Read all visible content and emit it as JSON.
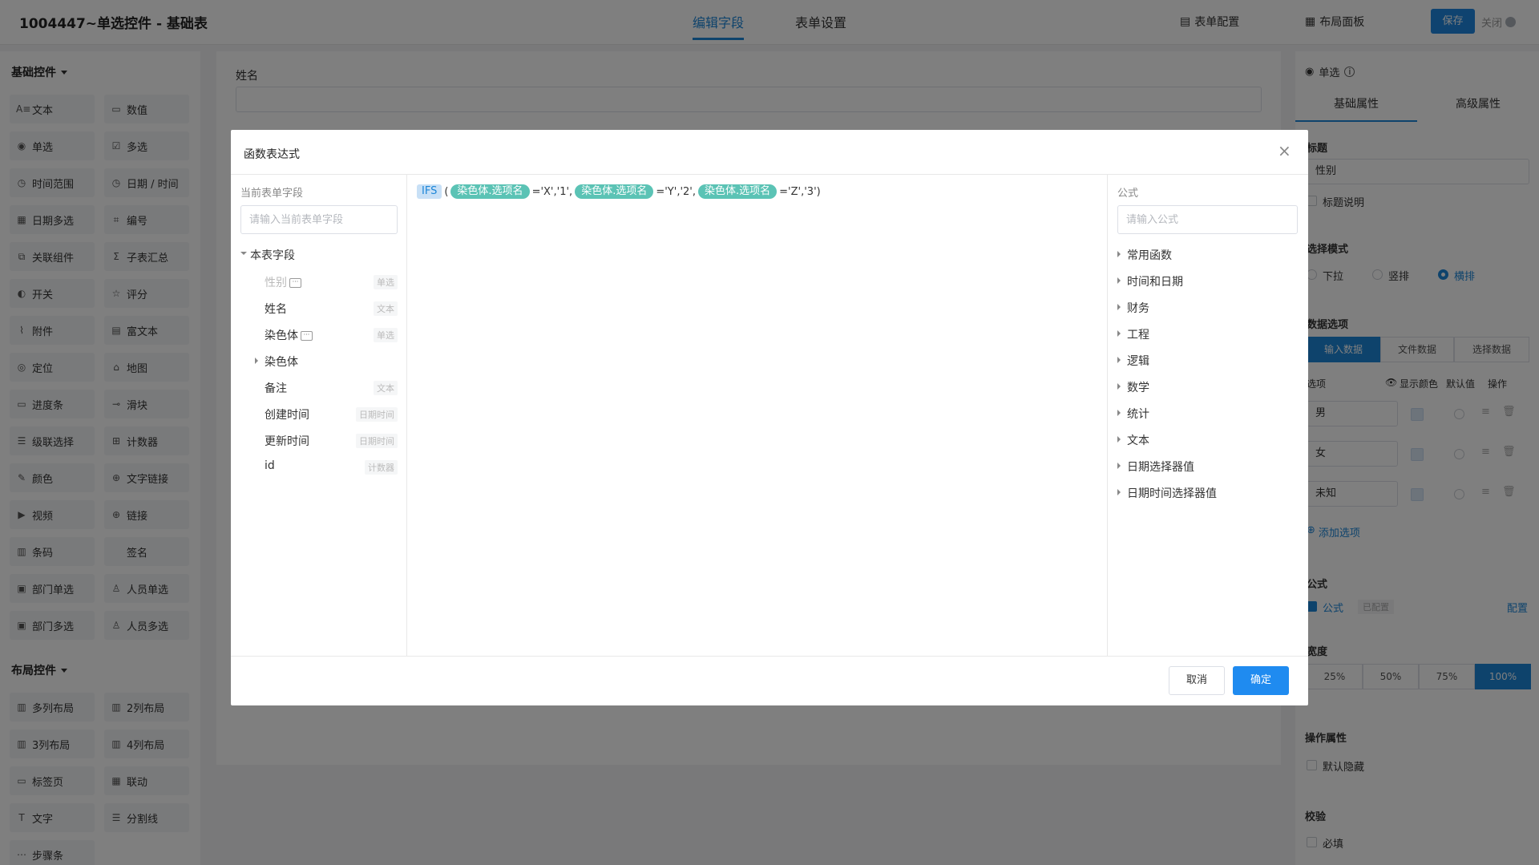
{
  "header": {
    "title": "1004447~单选控件 - 基础表",
    "tabs": [
      "编辑字段",
      "表单设置"
    ],
    "form_config": "表单配置",
    "layout_panel": "布局面板",
    "save": "保存",
    "close": "关闭"
  },
  "left": {
    "basic_title": "基础控件",
    "basic": [
      {
        "label": "文本",
        "icon": "text-icon"
      },
      {
        "label": "数值",
        "icon": "number-icon"
      },
      {
        "label": "单选",
        "icon": "radio-icon"
      },
      {
        "label": "多选",
        "icon": "checkbox-icon"
      },
      {
        "label": "时间范围",
        "icon": "clock-icon"
      },
      {
        "label": "日期 / 时间",
        "icon": "clock-icon"
      },
      {
        "label": "日期多选",
        "icon": "calendar-icon"
      },
      {
        "label": "编号",
        "icon": "id-icon"
      },
      {
        "label": "关联组件",
        "icon": "link-component-icon"
      },
      {
        "label": "子表汇总",
        "icon": "sigma-icon"
      },
      {
        "label": "开关",
        "icon": "toggle-icon"
      },
      {
        "label": "评分",
        "icon": "star-icon"
      },
      {
        "label": "附件",
        "icon": "paperclip-icon"
      },
      {
        "label": "富文本",
        "icon": "richtext-icon"
      },
      {
        "label": "定位",
        "icon": "location-icon"
      },
      {
        "label": "地图",
        "icon": "map-icon"
      },
      {
        "label": "进度条",
        "icon": "progress-icon"
      },
      {
        "label": "滑块",
        "icon": "slider-icon"
      },
      {
        "label": "级联选择",
        "icon": "cascade-icon"
      },
      {
        "label": "计数器",
        "icon": "counter-icon"
      },
      {
        "label": "颜色",
        "icon": "color-picker-icon"
      },
      {
        "label": "文字链接",
        "icon": "globe-icon"
      },
      {
        "label": "视频",
        "icon": "video-icon"
      },
      {
        "label": "链接",
        "icon": "globe-icon"
      },
      {
        "label": "条码",
        "icon": "barcode-icon"
      },
      {
        "label": "签名",
        "icon": ""
      },
      {
        "label": "部门单选",
        "icon": "department-icon"
      },
      {
        "label": "人员单选",
        "icon": "user-icon"
      },
      {
        "label": "部门多选",
        "icon": "department-icon"
      },
      {
        "label": "人员多选",
        "icon": "users-icon"
      }
    ],
    "layout_title": "布局控件",
    "layout": [
      {
        "label": "多列布局",
        "icon": "columns-icon"
      },
      {
        "label": "2列布局",
        "icon": "columns-icon"
      },
      {
        "label": "3列布局",
        "icon": "columns-icon"
      },
      {
        "label": "4列布局",
        "icon": "columns-icon"
      },
      {
        "label": "标签页",
        "icon": "tabs-icon"
      },
      {
        "label": "联动",
        "icon": "grid-icon"
      },
      {
        "label": "文字",
        "icon": "text-t-icon"
      },
      {
        "label": "分割线",
        "icon": "divider-icon"
      },
      {
        "label": "步骤条",
        "icon": "steps-icon"
      }
    ]
  },
  "canvas": {
    "field_label": "姓名"
  },
  "right": {
    "type_label": "单选",
    "tabs": [
      "基础属性",
      "高级属性"
    ],
    "title_label": "标题",
    "title_value": "性别",
    "title_desc": "标题说明",
    "mode_label": "选择模式",
    "modes": [
      "下拉",
      "竖排",
      "横排"
    ],
    "data_label": "数据选项",
    "data_tabs": [
      "输入数据",
      "文件数据",
      "选择数据"
    ],
    "option_cols": [
      "选项",
      "显示颜色",
      "默认值",
      "操作"
    ],
    "options": [
      "男",
      "女",
      "未知"
    ],
    "add_option": "添加选项",
    "formula_label": "公式",
    "formula_check": "公式",
    "formula_status": "已配置",
    "formula_config": "配置",
    "width_label": "宽度",
    "widths": [
      "25%",
      "50%",
      "75%",
      "100%"
    ],
    "op_label": "操作属性",
    "default_hidden": "默认隐藏",
    "validate_label": "校验",
    "required": "必填"
  },
  "modal": {
    "title": "函数表达式",
    "fields_title": "当前表单字段",
    "fields_placeholder": "请输入当前表单字段",
    "group": "本表字段",
    "fields": [
      {
        "label": "性别",
        "tag": "单选",
        "disabled": true,
        "more": true
      },
      {
        "label": "姓名",
        "tag": "文本",
        "disabled": false,
        "more": false
      },
      {
        "label": "染色体",
        "tag": "单选",
        "disabled": false,
        "more": true
      },
      {
        "label": "染色体",
        "tag": "",
        "disabled": false,
        "more": false,
        "expandable": true
      },
      {
        "label": "备注",
        "tag": "文本",
        "disabled": false,
        "more": false
      },
      {
        "label": "创建时间",
        "tag": "日期时间",
        "disabled": false,
        "more": false
      },
      {
        "label": "更新时间",
        "tag": "日期时间",
        "disabled": false,
        "more": false
      },
      {
        "label": "id",
        "tag": "计数器",
        "disabled": false,
        "more": false
      }
    ],
    "expression": {
      "fn": "IFS",
      "open": "(",
      "field": "染色体.选项名",
      "parts": [
        "='X','1',",
        "='Y','2',",
        "='Z','3')"
      ]
    },
    "formula_title": "公式",
    "formula_placeholder": "请输入公式",
    "categories": [
      "常用函数",
      "时间和日期",
      "财务",
      "工程",
      "逻辑",
      "数学",
      "统计",
      "文本",
      "日期选择器值",
      "日期时间选择器值"
    ],
    "cancel": "取消",
    "ok": "确定"
  }
}
